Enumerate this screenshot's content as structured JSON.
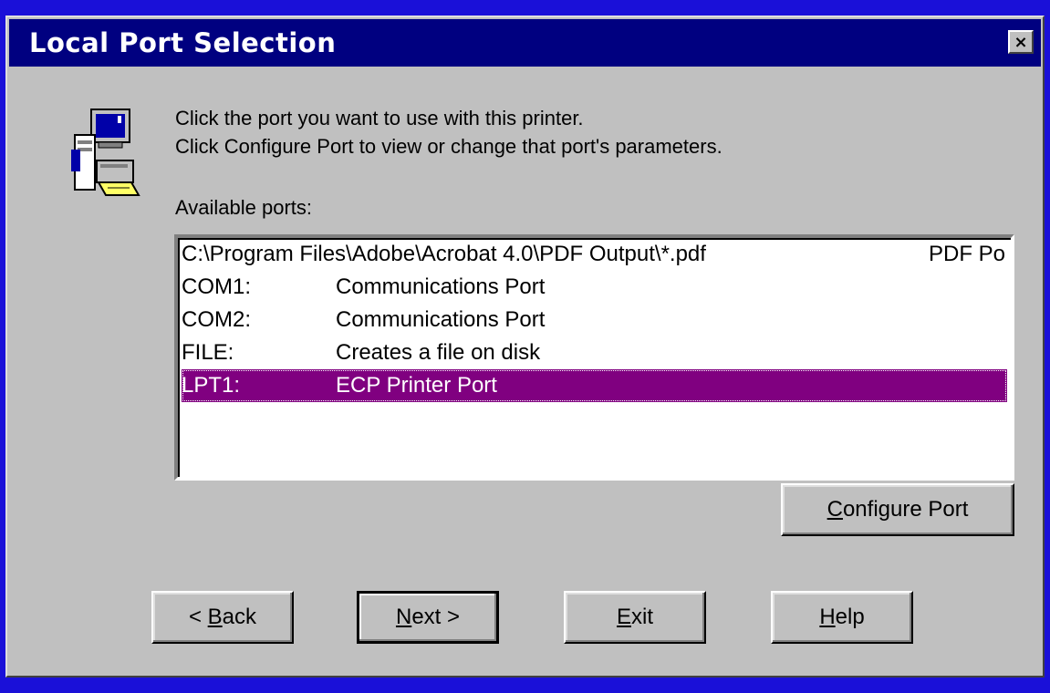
{
  "window": {
    "title": "Local Port Selection",
    "close_glyph": "×"
  },
  "instructions": {
    "line1": "Click the port you want to use with this printer.",
    "line2": "Click Configure Port to view or change that port's parameters."
  },
  "ports_label": "Available ports:",
  "ports": [
    {
      "port": "C:\\Program Files\\Adobe\\Acrobat 4.0\\PDF Output\\*.pdf",
      "description": "",
      "extra": "PDF Po",
      "selected": false
    },
    {
      "port": "COM1:",
      "description": "Communications Port",
      "extra": "",
      "selected": false
    },
    {
      "port": "COM2:",
      "description": "Communications Port",
      "extra": "",
      "selected": false
    },
    {
      "port": "FILE:",
      "description": "Creates a file on disk",
      "extra": "",
      "selected": false
    },
    {
      "port": "LPT1:",
      "description": "ECP Printer Port",
      "extra": "",
      "selected": true
    }
  ],
  "buttons": {
    "configure": {
      "accel": "C",
      "rest": "onfigure Port"
    },
    "back": {
      "pre": "< ",
      "accel": "B",
      "rest": "ack"
    },
    "next": {
      "accel": "N",
      "rest": "ext >"
    },
    "exit": {
      "accel": "E",
      "rest": "xit"
    },
    "help": {
      "accel": "H",
      "rest": "elp"
    }
  },
  "icons": {
    "wizard": "printer-computer-icon",
    "close": "close-icon"
  },
  "colors": {
    "title_bar": "#000080",
    "selection": "#800080",
    "face": "#c0c0c0",
    "desktop": "#1a10d8"
  }
}
